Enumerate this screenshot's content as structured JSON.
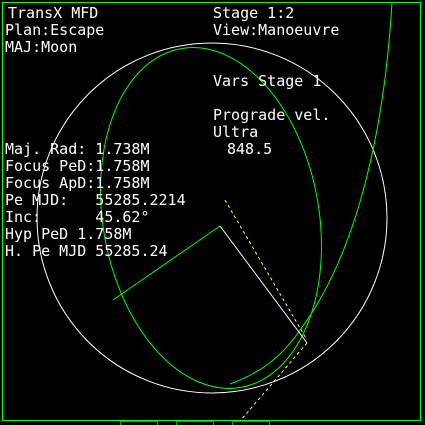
{
  "header": {
    "app_title": "TransX MFD",
    "plan": "Plan:Escape",
    "major": "MAJ:Moon",
    "stage": "Stage 1:2",
    "view": "View:Manoeuvre"
  },
  "variables": {
    "stage_title": "Vars Stage 1",
    "selected_name": "Prograde vel.",
    "adjust_mode": "Ultra",
    "selected_value": "848.5"
  },
  "readouts": {
    "maj_rad": "Maj. Rad: 1.738M",
    "focus_ped": "Focus PeD:1.758M",
    "focus_apd": "Focus ApD:1.758M",
    "pe_mjd": "Pe MJD:   55285.2214",
    "inc": "Inc:      45.62°",
    "hyp_ped": "Hyp PeD 1.758M",
    "h_pe_mjd": "H. Pe MJD 55285.24"
  },
  "colors": {
    "text": "#ffffff",
    "orbit": "#00ff00",
    "body": "#ffffff",
    "frame": "#00ff00",
    "hyperbola": "#ffff66"
  }
}
